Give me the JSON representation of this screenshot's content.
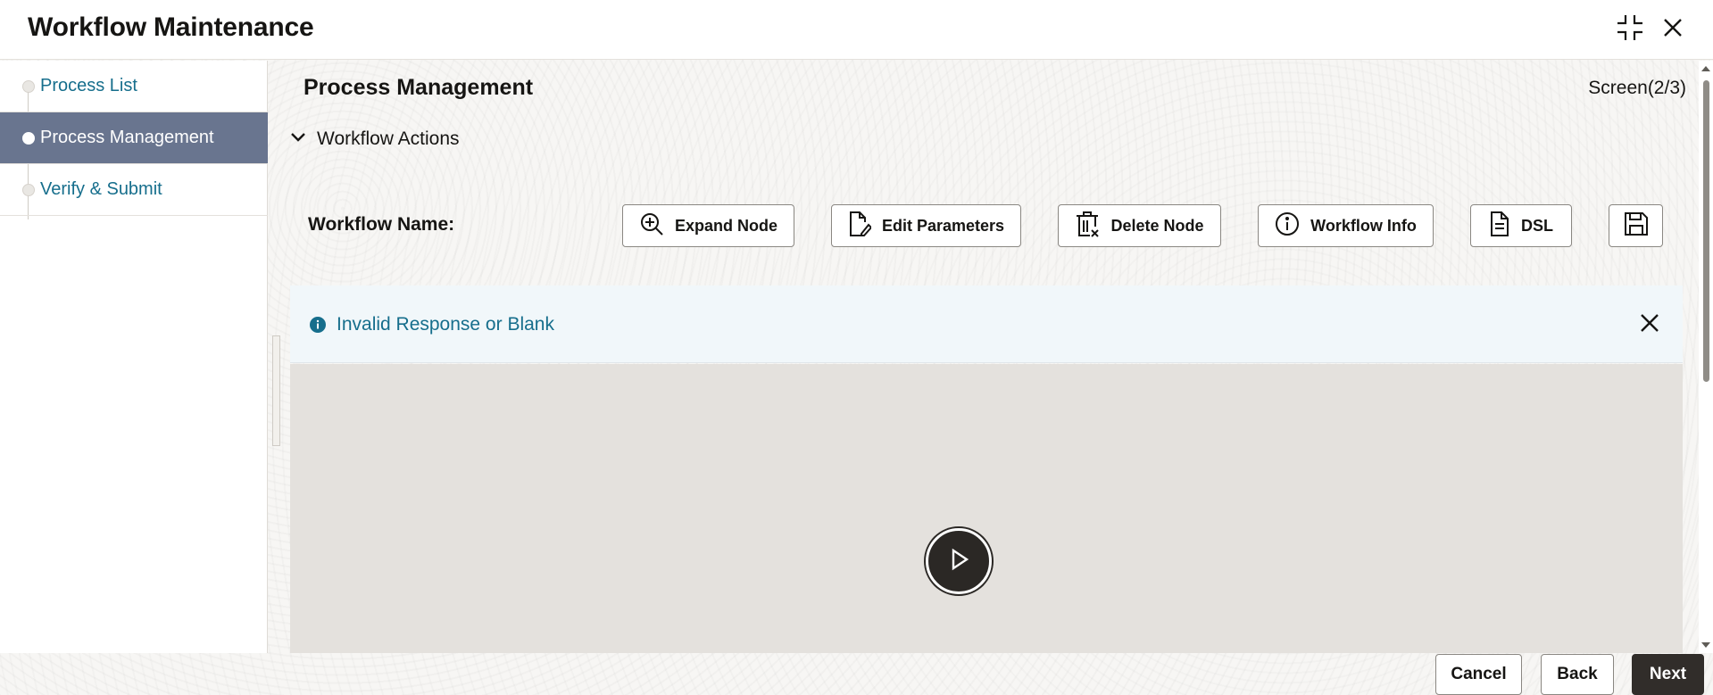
{
  "header": {
    "title": "Workflow Maintenance",
    "minimize_icon": "compress-icon",
    "close_icon": "close-icon"
  },
  "sidebar": {
    "items": [
      {
        "label": "Process List",
        "active": false
      },
      {
        "label": "Process Management",
        "active": true
      },
      {
        "label": "Verify & Submit",
        "active": false
      }
    ]
  },
  "main": {
    "title": "Process Management",
    "screen_indicator": "Screen(2/3)",
    "section": {
      "label": "Workflow Actions",
      "expanded": true
    },
    "workflow_name_label": "Workflow Name:",
    "actions": [
      {
        "label": "Expand Node",
        "icon": "zoom-in-icon"
      },
      {
        "label": "Edit Parameters",
        "icon": "edit-document-icon"
      },
      {
        "label": "Delete Node",
        "icon": "delete-icon"
      },
      {
        "label": "Workflow Info",
        "icon": "info-icon"
      },
      {
        "label": "DSL",
        "icon": "document-icon"
      },
      {
        "label": "",
        "icon": "save-icon"
      }
    ],
    "alert": {
      "message": "Invalid Response or Blank",
      "icon": "info-filled-icon"
    }
  },
  "footer": {
    "cancel_label": "Cancel",
    "back_label": "Back",
    "next_label": "Next"
  },
  "colors": {
    "link": "#166e8c",
    "active_nav": "#69758f",
    "primary_button": "#312d2a",
    "alert_bg": "#f1f7fa",
    "canvas_bg": "#e4e1dd"
  }
}
